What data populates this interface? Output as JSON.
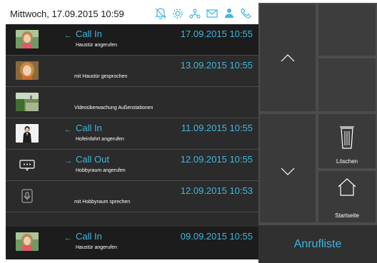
{
  "header": {
    "title": "Mittwoch, 17.09.2015 10:59",
    "icons": [
      "bell-off-icon",
      "gear-icon",
      "network-icon",
      "mail-icon",
      "person-icon",
      "phone-icon"
    ],
    "icon_color": "#3fb7e0"
  },
  "calls": [
    {
      "thumb": "woman-photo",
      "direction": "in",
      "arrow": "←",
      "type": "Call In",
      "desc": "Haustür angerufen",
      "date": "17.09.2015 10:55",
      "selected": true
    },
    {
      "thumb": "woman-photo-2",
      "direction": "",
      "arrow": "",
      "type": "",
      "desc": "mit Haustür gesprochen",
      "date": "13.09.2015 10:55",
      "selected": false
    },
    {
      "thumb": "garden-photo",
      "direction": "",
      "arrow": "",
      "type": "",
      "desc": "Videoüberwachung Außenstationen",
      "date": "",
      "selected": false
    },
    {
      "thumb": "woman-suit-photo",
      "direction": "in",
      "arrow": "←",
      "type": "Call In",
      "desc": "Hofeinfahrt angerufen",
      "date": "11.09.2015 10:55",
      "selected": false
    },
    {
      "thumb": "intercom-icon",
      "direction": "out",
      "arrow": "→",
      "type": "Call Out",
      "desc": "Hobbyraum angerufen",
      "date": "12.09.2015 10:55",
      "selected": false
    },
    {
      "thumb": "microphone-icon",
      "direction": "",
      "arrow": "",
      "type": "",
      "desc": "mit Hobbyraum sprechen",
      "date": "12.09.2015 10:53",
      "selected": false
    },
    {
      "thumb": "woman-photo",
      "direction": "in",
      "arrow": "←",
      "type": "Call In",
      "desc": "Haustür angerufen",
      "date": "09.09.2015 10:55",
      "selected": false
    }
  ],
  "sidebar": {
    "up_icon": "chevron-up-icon",
    "down_icon": "chevron-down-icon",
    "delete_label": "Löschen",
    "delete_icon": "trash-icon",
    "home_label": "Startseite",
    "home_icon": "home-icon",
    "calllist_label": "Anrufliste"
  },
  "colors": {
    "accent": "#3fb7e0",
    "call_in_arrow": "#3ec87a",
    "list_bg": "#2b2b2b",
    "tile_bg": "#3a3a3a"
  }
}
